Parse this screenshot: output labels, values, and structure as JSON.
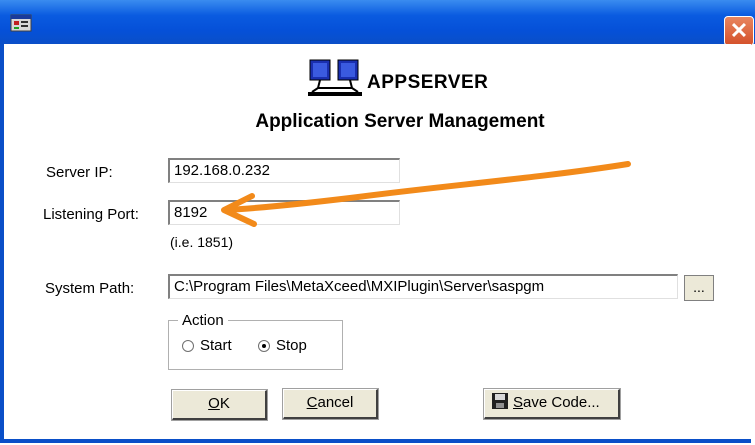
{
  "brand": {
    "name": "APPSERVER",
    "subtitle": "Application Server Management"
  },
  "form": {
    "server_ip_label": "Server IP:",
    "server_ip_value": "192.168.0.232",
    "port_label": "Listening Port:",
    "port_value": "8192",
    "port_hint": "(i.e. 1851)",
    "path_label": "System Path:",
    "path_value": "C:\\Program Files\\MetaXceed\\MXIPlugin\\Server\\saspgm",
    "browse_label": "..."
  },
  "action": {
    "legend": "Action",
    "options": [
      {
        "label": "Start",
        "selected": false
      },
      {
        "label": "Stop",
        "selected": true
      }
    ]
  },
  "buttons": {
    "ok_mnemonic": "O",
    "ok_rest": "K",
    "cancel_mnemonic": "C",
    "cancel_rest": "ancel",
    "save_mnemonic": "S",
    "save_rest": "ave Code..."
  },
  "titlebar": {
    "close_glyph": "✕"
  },
  "colors": {
    "titlebar": "#0a5be0",
    "annotation_arrow": "#f28a1a",
    "close_button": "#d4502a"
  }
}
